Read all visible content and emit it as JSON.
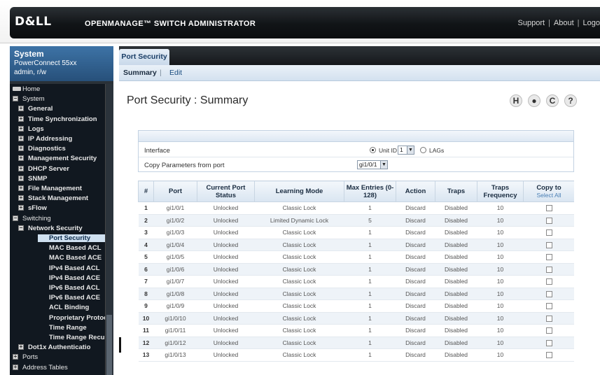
{
  "header": {
    "logo": "D&LL",
    "title": "OPENMANAGE™ SWITCH ADMINISTRATOR",
    "links": [
      "Support",
      "About",
      "Logo"
    ]
  },
  "sidebar": {
    "device": {
      "title": "System",
      "model": "PowerConnect 55xx",
      "user": "admin, r/w"
    },
    "tree": [
      {
        "label": "Home",
        "expander": "",
        "indent": 0,
        "bold": false,
        "selected": false
      },
      {
        "label": "System",
        "expander": "−",
        "indent": 0,
        "bold": false,
        "selected": false
      },
      {
        "label": "General",
        "expander": "+",
        "indent": 1,
        "bold": true,
        "selected": false
      },
      {
        "label": "Time Synchronization",
        "expander": "+",
        "indent": 1,
        "bold": true,
        "selected": false
      },
      {
        "label": "Logs",
        "expander": "+",
        "indent": 1,
        "bold": true,
        "selected": false
      },
      {
        "label": "IP Addressing",
        "expander": "+",
        "indent": 1,
        "bold": true,
        "selected": false
      },
      {
        "label": "Diagnostics",
        "expander": "+",
        "indent": 1,
        "bold": true,
        "selected": false
      },
      {
        "label": "Management Security",
        "expander": "+",
        "indent": 1,
        "bold": true,
        "selected": false
      },
      {
        "label": "DHCP Server",
        "expander": "+",
        "indent": 1,
        "bold": true,
        "selected": false
      },
      {
        "label": "SNMP",
        "expander": "+",
        "indent": 1,
        "bold": true,
        "selected": false
      },
      {
        "label": "File Management",
        "expander": "+",
        "indent": 1,
        "bold": true,
        "selected": false
      },
      {
        "label": "Stack Management",
        "expander": "+",
        "indent": 1,
        "bold": true,
        "selected": false
      },
      {
        "label": "sFlow",
        "expander": "+",
        "indent": 1,
        "bold": true,
        "selected": false
      },
      {
        "label": "Switching",
        "expander": "−",
        "indent": 0,
        "bold": false,
        "selected": false
      },
      {
        "label": "Network Security",
        "expander": "−",
        "indent": 1,
        "bold": true,
        "selected": false
      },
      {
        "label": "Port Security",
        "expander": "",
        "indent": 2,
        "bold": true,
        "selected": true
      },
      {
        "label": "MAC Based ACL",
        "expander": "",
        "indent": 2,
        "bold": true,
        "selected": false
      },
      {
        "label": "MAC Based ACE",
        "expander": "",
        "indent": 2,
        "bold": true,
        "selected": false
      },
      {
        "label": "IPv4 Based ACL",
        "expander": "",
        "indent": 2,
        "bold": true,
        "selected": false
      },
      {
        "label": "IPv4 Based ACE",
        "expander": "",
        "indent": 2,
        "bold": true,
        "selected": false
      },
      {
        "label": "IPv6 Based ACL",
        "expander": "",
        "indent": 2,
        "bold": true,
        "selected": false
      },
      {
        "label": "IPv6 Based ACE",
        "expander": "",
        "indent": 2,
        "bold": true,
        "selected": false
      },
      {
        "label": "ACL Binding",
        "expander": "",
        "indent": 2,
        "bold": true,
        "selected": false
      },
      {
        "label": "Proprietary Protocol",
        "expander": "",
        "indent": 2,
        "bold": true,
        "selected": false
      },
      {
        "label": "Time Range",
        "expander": "",
        "indent": 2,
        "bold": true,
        "selected": false
      },
      {
        "label": "Time Range Recu",
        "expander": "",
        "indent": 2,
        "bold": true,
        "selected": false
      },
      {
        "label": "Dot1x Authenticatio",
        "expander": "+",
        "indent": 1,
        "bold": true,
        "selected": false
      },
      {
        "label": "Ports",
        "expander": "+",
        "indent": 0,
        "bold": false,
        "selected": false
      },
      {
        "label": "Address Tables",
        "expander": "+",
        "indent": 0,
        "bold": false,
        "selected": false
      }
    ]
  },
  "main": {
    "tab": "Port Security",
    "subtabs": {
      "summary": "Summary",
      "edit": "Edit"
    },
    "page_title": "Port Security : Summary",
    "tools": {
      "save": "H",
      "print": "●",
      "refresh": "C",
      "help": "?"
    },
    "interface": {
      "label": "Interface",
      "unit_label": "Unit ID",
      "unit_value": "1",
      "lags_label": "LAGs",
      "copy_label": "Copy Parameters from port",
      "copy_value": "gi1/0/1"
    },
    "table": {
      "columns": [
        "#",
        "Port",
        "Current Port Status",
        "Learning Mode",
        "Max Entries (0-128)",
        "Action",
        "Traps",
        "Traps Frequency",
        "Copy to"
      ],
      "select_all": "Select All",
      "rows": [
        [
          "1",
          "gi1/0/1",
          "Unlocked",
          "Classic Lock",
          "1",
          "Discard",
          "Disabled",
          "10"
        ],
        [
          "2",
          "gi1/0/2",
          "Unlocked",
          "Limited Dynamic Lock",
          "5",
          "Discard",
          "Disabled",
          "10"
        ],
        [
          "3",
          "gi1/0/3",
          "Unlocked",
          "Classic Lock",
          "1",
          "Discard",
          "Disabled",
          "10"
        ],
        [
          "4",
          "gi1/0/4",
          "Unlocked",
          "Classic Lock",
          "1",
          "Discard",
          "Disabled",
          "10"
        ],
        [
          "5",
          "gi1/0/5",
          "Unlocked",
          "Classic Lock",
          "1",
          "Discard",
          "Disabled",
          "10"
        ],
        [
          "6",
          "gi1/0/6",
          "Unlocked",
          "Classic Lock",
          "1",
          "Discard",
          "Disabled",
          "10"
        ],
        [
          "7",
          "gi1/0/7",
          "Unlocked",
          "Classic Lock",
          "1",
          "Discard",
          "Disabled",
          "10"
        ],
        [
          "8",
          "gi1/0/8",
          "Unlocked",
          "Classic Lock",
          "1",
          "Discard",
          "Disabled",
          "10"
        ],
        [
          "9",
          "gi1/0/9",
          "Unlocked",
          "Classic Lock",
          "1",
          "Discard",
          "Disabled",
          "10"
        ],
        [
          "10",
          "gi1/0/10",
          "Unlocked",
          "Classic Lock",
          "1",
          "Discard",
          "Disabled",
          "10"
        ],
        [
          "11",
          "gi1/0/11",
          "Unlocked",
          "Classic Lock",
          "1",
          "Discard",
          "Disabled",
          "10"
        ],
        [
          "12",
          "gi1/0/12",
          "Unlocked",
          "Classic Lock",
          "1",
          "Discard",
          "Disabled",
          "10"
        ],
        [
          "13",
          "gi1/0/13",
          "Unlocked",
          "Classic Lock",
          "1",
          "Discard",
          "Disabled",
          "10"
        ]
      ]
    }
  }
}
